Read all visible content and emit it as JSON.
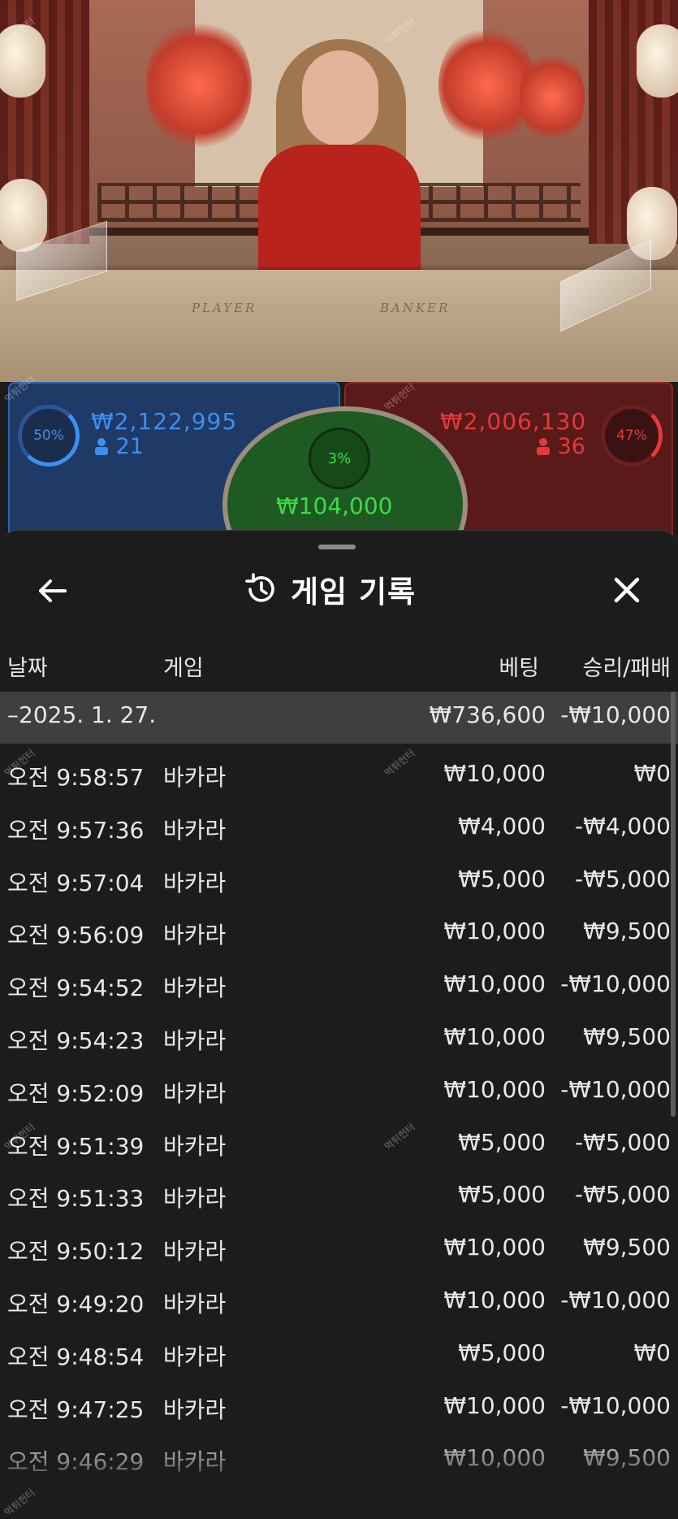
{
  "video": {
    "table_label_left": "PLAYER",
    "table_label_right": "BANKER"
  },
  "bets": {
    "player": {
      "percent": "50%",
      "amount": "₩2,122,995",
      "players": "21",
      "color": "#3d8ff0"
    },
    "banker": {
      "percent": "47%",
      "amount": "₩2,006,130",
      "players": "36",
      "color": "#e33a3a"
    },
    "tie": {
      "percent": "3%",
      "amount": "₩104,000",
      "color": "#3fd94a"
    }
  },
  "history": {
    "title": "게임 기록",
    "icons": {
      "back": "arrow-left-icon",
      "history": "history-icon",
      "close": "close-icon"
    },
    "columns": {
      "date": "날짜",
      "game": "게임",
      "bet": "베팅",
      "result": "승리/패배"
    },
    "date_group": {
      "date": "–2025. 1. 27.",
      "bet": "₩736,600",
      "result": "-₩10,000"
    },
    "rows": [
      {
        "time": "오전 9:58:57",
        "game": "바카라",
        "bet": "₩10,000",
        "result": "₩0"
      },
      {
        "time": "오전 9:57:36",
        "game": "바카라",
        "bet": "₩4,000",
        "result": "-₩4,000"
      },
      {
        "time": "오전 9:57:04",
        "game": "바카라",
        "bet": "₩5,000",
        "result": "-₩5,000"
      },
      {
        "time": "오전 9:56:09",
        "game": "바카라",
        "bet": "₩10,000",
        "result": "₩9,500"
      },
      {
        "time": "오전 9:54:52",
        "game": "바카라",
        "bet": "₩10,000",
        "result": "-₩10,000"
      },
      {
        "time": "오전 9:54:23",
        "game": "바카라",
        "bet": "₩10,000",
        "result": "₩9,500"
      },
      {
        "time": "오전 9:52:09",
        "game": "바카라",
        "bet": "₩10,000",
        "result": "-₩10,000"
      },
      {
        "time": "오전 9:51:39",
        "game": "바카라",
        "bet": "₩5,000",
        "result": "-₩5,000"
      },
      {
        "time": "오전 9:51:33",
        "game": "바카라",
        "bet": "₩5,000",
        "result": "-₩5,000"
      },
      {
        "time": "오전 9:50:12",
        "game": "바카라",
        "bet": "₩10,000",
        "result": "₩9,500"
      },
      {
        "time": "오전 9:49:20",
        "game": "바카라",
        "bet": "₩10,000",
        "result": "-₩10,000"
      },
      {
        "time": "오전 9:48:54",
        "game": "바카라",
        "bet": "₩5,000",
        "result": "₩0"
      },
      {
        "time": "오전 9:47:25",
        "game": "바카라",
        "bet": "₩10,000",
        "result": "-₩10,000"
      },
      {
        "time": "오전 9:46:29",
        "game": "바카라",
        "bet": "₩10,000",
        "result": "₩9,500"
      }
    ]
  }
}
